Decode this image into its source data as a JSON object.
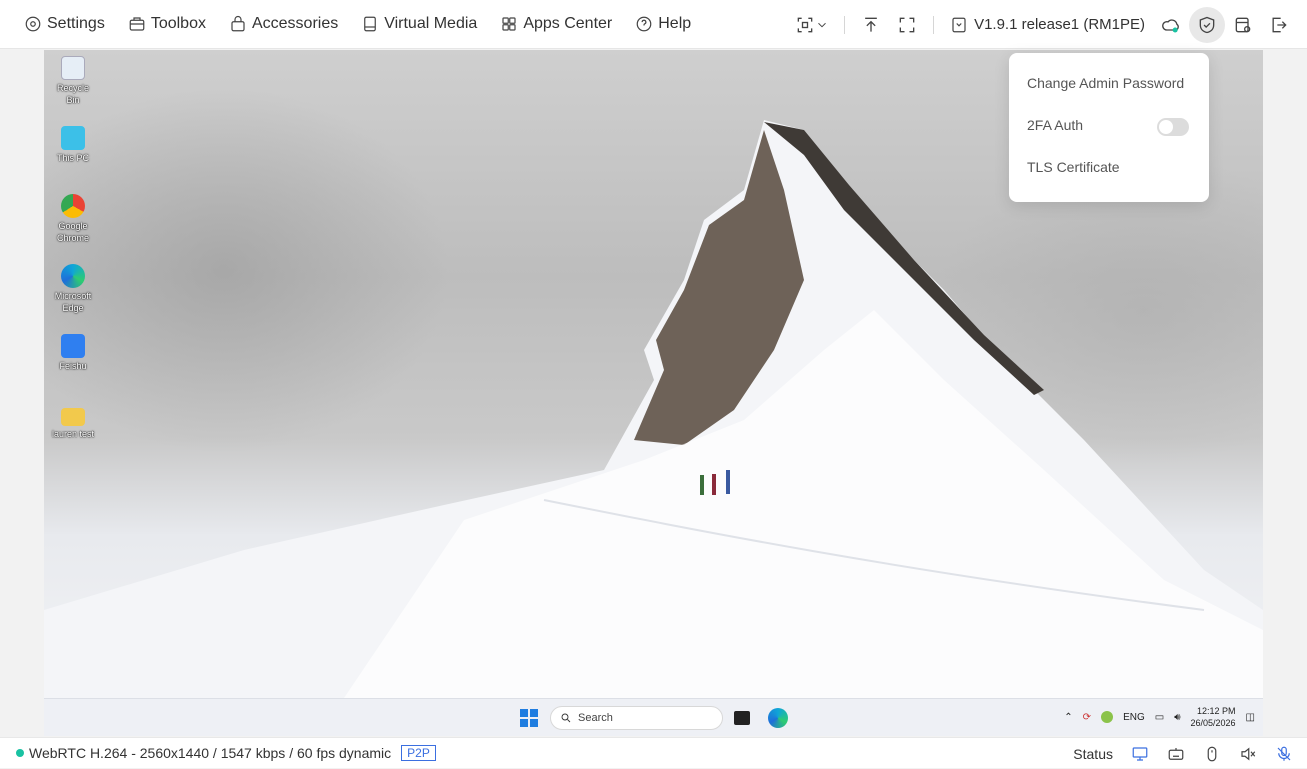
{
  "menu": {
    "settings": "Settings",
    "toolbox": "Toolbox",
    "accessories": "Accessories",
    "virtual_media": "Virtual Media",
    "apps_center": "Apps Center",
    "help": "Help"
  },
  "version": "V1.9.1 release1 (RM1PE)",
  "security_menu": {
    "change_password": "Change Admin Password",
    "twofa": "2FA Auth",
    "twofa_enabled": false,
    "tls": "TLS Certificate"
  },
  "desktop_icons": [
    {
      "label": "Recycle Bin"
    },
    {
      "label": "This PC"
    },
    {
      "label": "Google Chrome"
    },
    {
      "label": "Microsoft Edge"
    },
    {
      "label": "Feishu"
    },
    {
      "label": "lauren test"
    }
  ],
  "taskbar": {
    "search_placeholder": "Search",
    "language": "ENG",
    "time": "12:12 PM",
    "date": "26/05/2026"
  },
  "status": {
    "stream_info": "WebRTC H.264 - 2560x1440 / 1547 kbps / 60 fps dynamic",
    "mode_badge": "P2P",
    "status_label": "Status"
  },
  "colors": {
    "accent": "#3b6fe0",
    "online": "#19c2a2",
    "mic_off": "#3b6fe0"
  }
}
